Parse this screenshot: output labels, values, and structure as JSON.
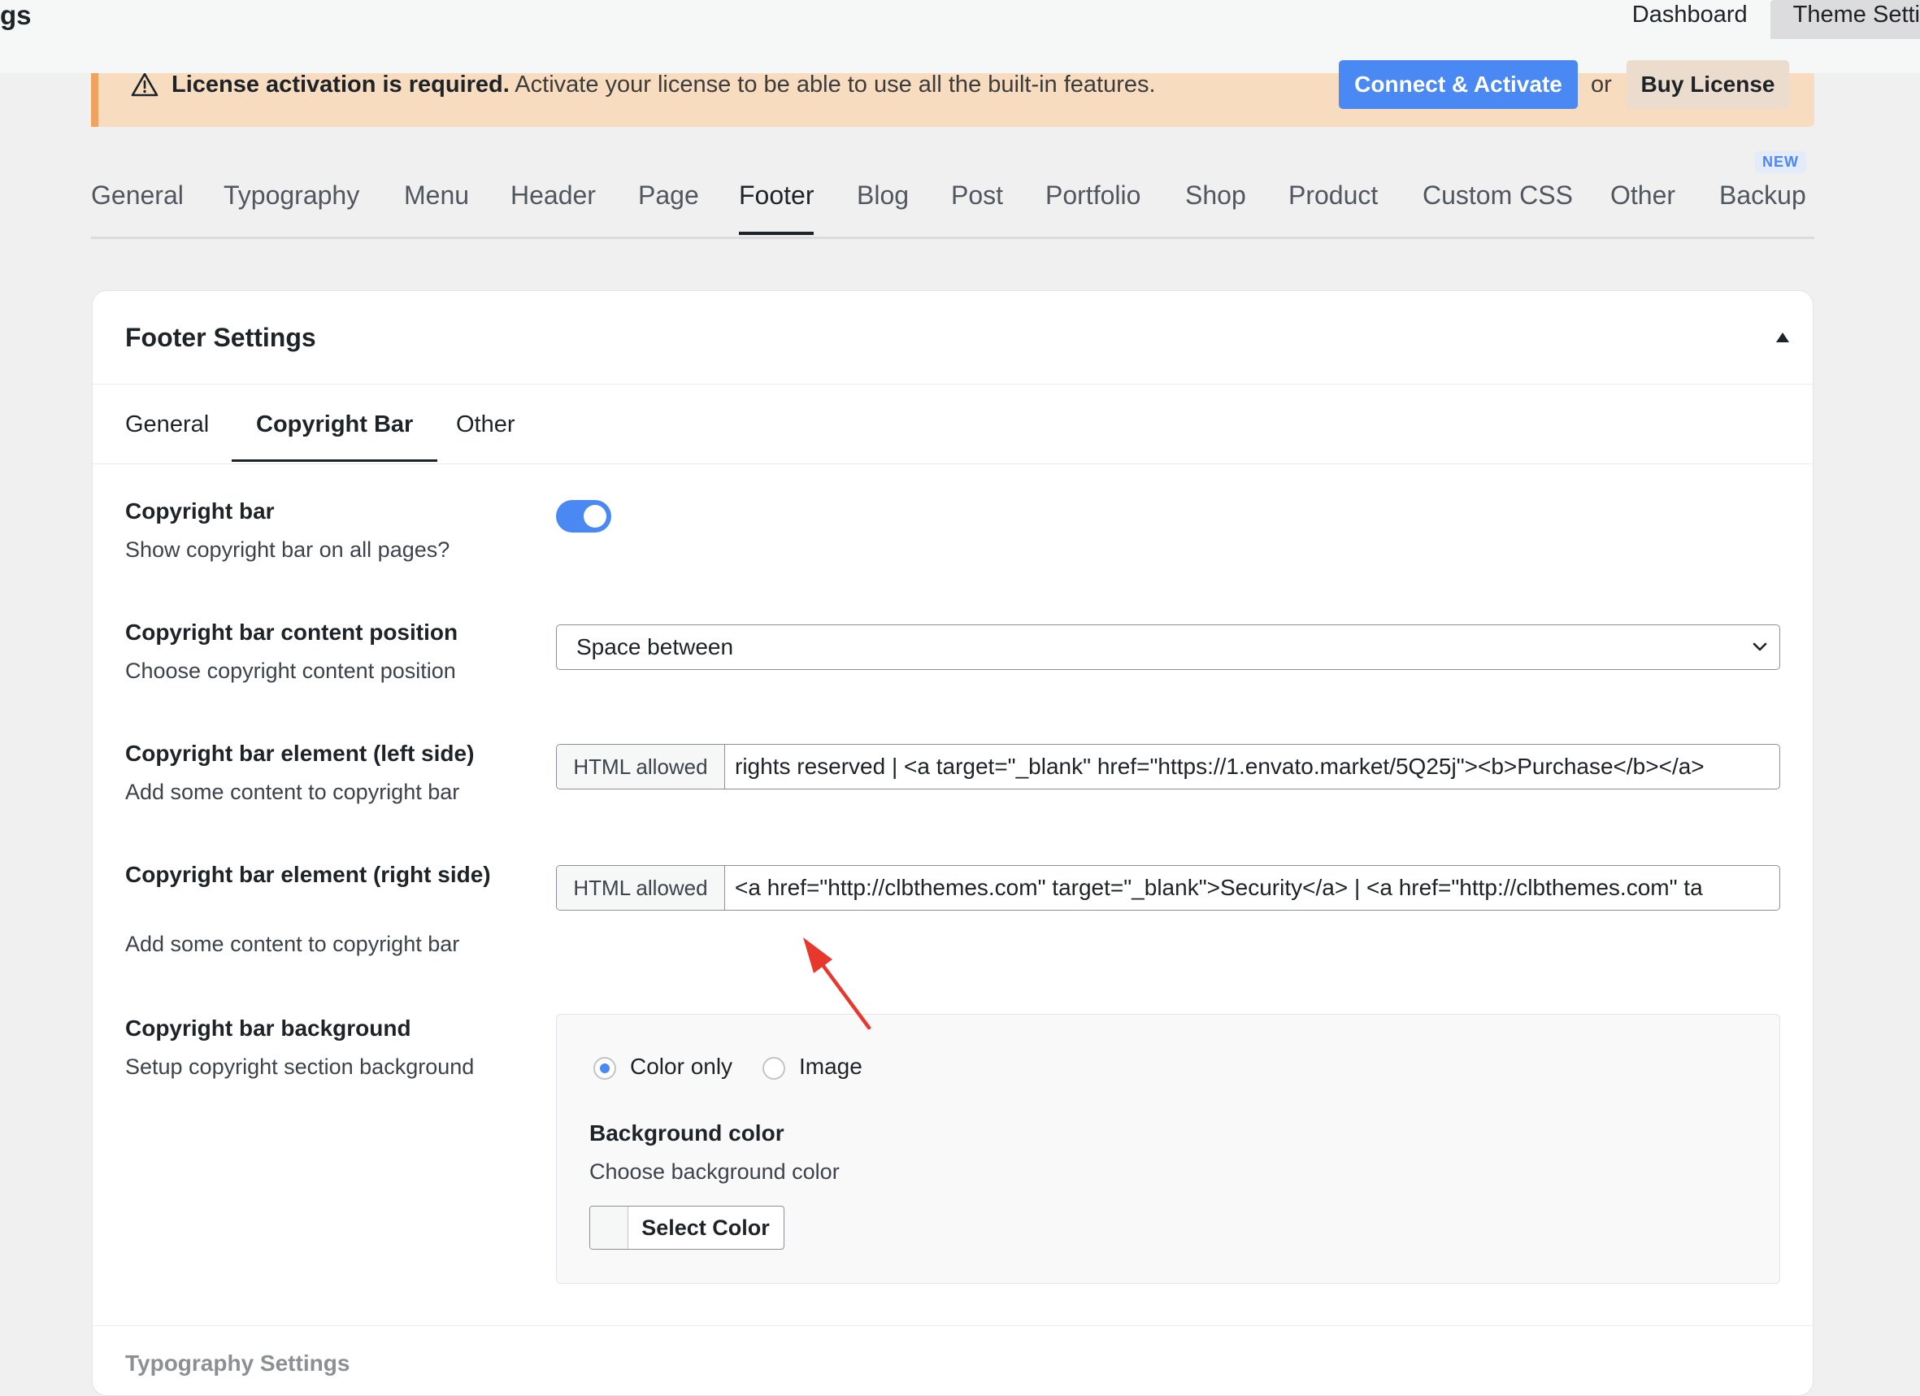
{
  "header": {
    "title_fragment": "gs",
    "tabs": [
      {
        "label": "Dashboard"
      },
      {
        "label": "Theme Setti"
      }
    ]
  },
  "notice": {
    "icon": "warning-icon",
    "bold": "License activation is required.",
    "text": "Activate your license to be able to use all the built-in features.",
    "connect_label": "Connect & Activate",
    "or_label": "or",
    "buy_label": "Buy License"
  },
  "main_tabs": [
    {
      "label": "General"
    },
    {
      "label": "Typography"
    },
    {
      "label": "Menu"
    },
    {
      "label": "Header"
    },
    {
      "label": "Page"
    },
    {
      "label": "Footer",
      "active": true
    },
    {
      "label": "Blog"
    },
    {
      "label": "Post"
    },
    {
      "label": "Portfolio"
    },
    {
      "label": "Shop"
    },
    {
      "label": "Product"
    },
    {
      "label": "Custom CSS"
    },
    {
      "label": "Other"
    },
    {
      "label": "Backup",
      "badge": "NEW"
    }
  ],
  "card": {
    "title": "Footer Settings",
    "sub_tabs": [
      {
        "label": "General"
      },
      {
        "label": "Copyright Bar",
        "active": true
      },
      {
        "label": "Other"
      }
    ],
    "rows": {
      "copyright_bar": {
        "label": "Copyright bar",
        "desc": "Show copyright bar on all pages?",
        "enabled": true
      },
      "position": {
        "label": "Copyright bar content position",
        "desc": "Choose copyright content position",
        "value": "Space between"
      },
      "left": {
        "label": "Copyright bar element (left side)",
        "desc": "Add some content to copyright bar",
        "prefix": "HTML allowed",
        "value": "rights reserved | <a target=\"_blank\" href=\"https://1.envato.market/5Q25j\"><b>Purchase</b></a>"
      },
      "right": {
        "label": "Copyright bar element (right side)",
        "desc": "Add some content to copyright bar",
        "prefix": "HTML allowed",
        "value": "<a href=\"http://clbthemes.com\" target=\"_blank\">Security</a> | <a href=\"http://clbthemes.com\" ta"
      },
      "background": {
        "label": "Copyright bar background",
        "desc": "Setup copyright section background",
        "options": [
          "Color only",
          "Image"
        ],
        "selected": "Color only",
        "bg_color_label": "Background color",
        "bg_color_desc": "Choose background color",
        "select_color_label": "Select Color"
      }
    },
    "next_section": "Typography Settings"
  },
  "colors": {
    "accent": "#4a89f3",
    "notice_bg": "#f8dcc0",
    "notice_border": "#f0a35e",
    "annotation_arrow": "#e8372c"
  }
}
